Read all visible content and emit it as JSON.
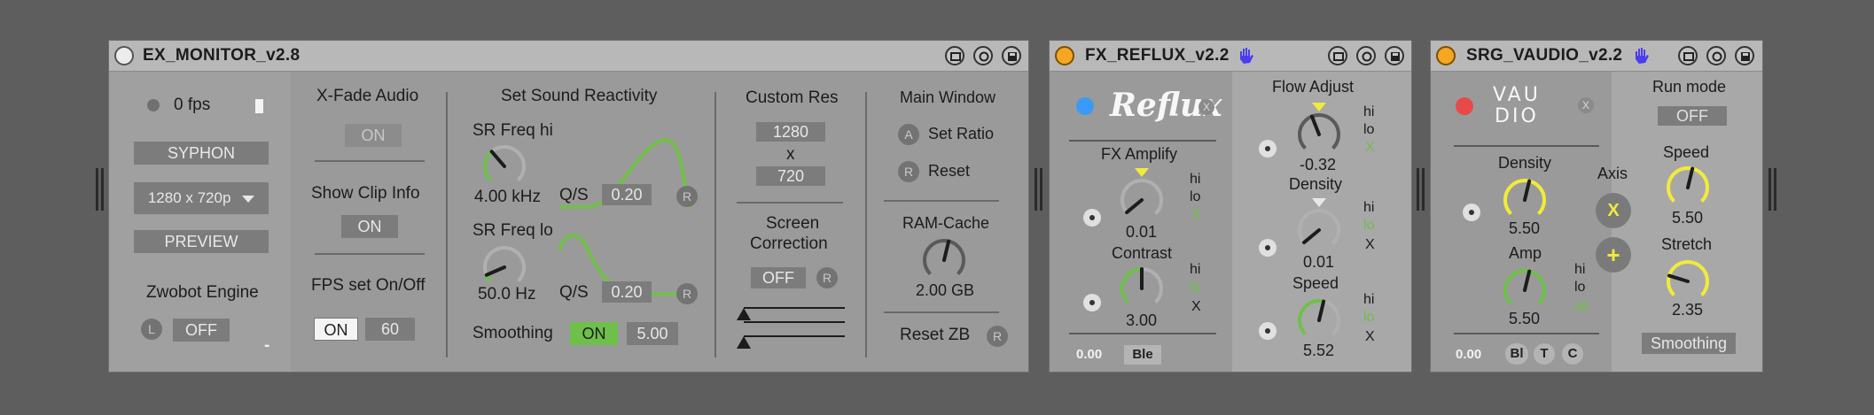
{
  "colors": {
    "green": "#6ec04b",
    "yellow": "#f2ea3c",
    "orange_power": "#f5a623",
    "blue_dot": "#3b9af5",
    "red_dot": "#e84a4a",
    "hand": "#4a3cf0"
  },
  "monitor": {
    "title": "EX_MONITOR_v2.8",
    "fps": "0 fps",
    "syphon": "SYPHON",
    "resolution": "1280 x 720p",
    "preview": "PREVIEW",
    "zwobot_label": "Zwobot Engine",
    "zwobot_l": "L",
    "zwobot_value": "OFF",
    "minus": "-",
    "xfade_label": "X-Fade Audio",
    "xfade_value": "ON",
    "clipinfo_label": "Show Clip Info",
    "clipinfo_value": "ON",
    "fps_label": "FPS set On/Off",
    "fps_on": "ON",
    "fps_value": "60",
    "sr_label": "Set Sound Reactivity",
    "sr_hi_label": "SR Freq hi",
    "sr_hi_value": "4.00 kHz",
    "sr_hi_level": 0.35,
    "qs_label_1": "Q/S",
    "qs_value_1": "0.20",
    "r1": "R",
    "sr_lo_label": "SR Freq lo",
    "sr_lo_value": "50.0 Hz",
    "sr_lo_level": 0.08,
    "qs_label_2": "Q/S",
    "qs_value_2": "0.20",
    "r2": "R",
    "smoothing_label": "Smoothing",
    "smoothing_on": "ON",
    "smoothing_value": "5.00",
    "custom_res_label": "Custom Res",
    "res_w": "1280",
    "res_x": "x",
    "res_h": "720",
    "screen_corr_label_1": "Screen",
    "screen_corr_label_2": "Correction",
    "screen_corr_value": "OFF",
    "r3": "R",
    "main_window_label": "Main Window",
    "set_ratio_icon": "A",
    "set_ratio_label": "Set Ratio",
    "reset_icon": "R",
    "reset_label": "Reset",
    "ramcache_label": "RAM-Cache",
    "ramcache_value": "2.00 GB",
    "ramcache_level": 0.55,
    "resetzb_label": "Reset ZB",
    "r4": "R"
  },
  "reflux": {
    "title": "FX_REFLUX_v2.2",
    "logo": "Reflux",
    "close": "X",
    "fx_amp_label": "FX Amplify",
    "fx_amp_value": "0.01",
    "fx_amp_level": 0.02,
    "hi": "hi",
    "lo": "lo",
    "x": "X",
    "contrast_label": "Contrast",
    "contrast_value": "3.00",
    "contrast_level": 0.5,
    "counter": "0.00",
    "ble": "Ble",
    "flow_label": "Flow Adjust",
    "flow_value": "-0.32",
    "flow_level": 0.42,
    "density_label": "Density",
    "density_value": "0.01",
    "density_level": 0.02,
    "speed_label": "Speed",
    "speed_value": "5.52",
    "speed_level": 0.55
  },
  "vaudio": {
    "title": "SRG_VAUDIO_v2.2",
    "logo_line1": "VAU",
    "logo_line2": "DIO",
    "close": "X",
    "density_label": "Density",
    "density_value": "5.50",
    "density_level": 0.55,
    "amp_label": "Amp",
    "amp_value": "5.50",
    "amp_level": 0.55,
    "axis_label": "Axis",
    "axis_x": "X",
    "axis_plus": "+",
    "hi": "hi",
    "lo": "lo",
    "all": "all",
    "counter": "0.00",
    "bi": "Bl",
    "t": "T",
    "c": "C",
    "runmode_label": "Run mode",
    "runmode_value": "OFF",
    "speed_label": "Speed",
    "speed_value": "5.50",
    "speed_level": 0.55,
    "stretch_label": "Stretch",
    "stretch_value": "2.35",
    "stretch_level": 0.23,
    "smoothing": "Smoothing"
  }
}
